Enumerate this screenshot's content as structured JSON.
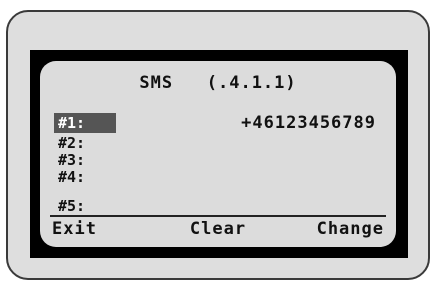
{
  "screen": {
    "title": "SMS   (.4.1.1)"
  },
  "slots": [
    {
      "label": "#1:",
      "value": "+46123456789",
      "selected": true
    },
    {
      "label": "#2:",
      "value": "",
      "selected": false
    },
    {
      "label": "#3:",
      "value": "",
      "selected": false
    },
    {
      "label": "#4:",
      "value": "",
      "selected": false
    },
    {
      "label": "#5:",
      "value": "",
      "selected": false
    }
  ],
  "softkeys": {
    "left": "Exit",
    "center": "Clear",
    "right": "Change"
  },
  "colors": {
    "lcd_background": "#dcdcdc",
    "bezel": "#000000",
    "device_body": "#dedede",
    "selection_highlight": "#555555"
  }
}
